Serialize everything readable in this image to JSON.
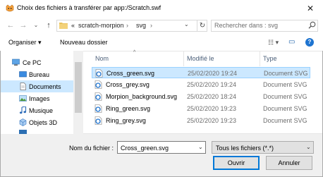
{
  "window": {
    "title": "Choix des fichiers à transférer par app:/Scratch.swf",
    "close_glyph": "✕"
  },
  "nav": {
    "back_glyph": "←",
    "forward_glyph": "→",
    "recent_glyph": "⌄",
    "up_glyph": "↑",
    "breadcrumb_prefix": "«",
    "breadcrumbs": [
      "scratch-morpion",
      "svg"
    ],
    "separator": "›",
    "refresh_glyph": "↻",
    "dropdown_glyph": "⌄",
    "search_placeholder": "Rechercher dans : svg"
  },
  "toolbar": {
    "organize_label": "Organiser ▾",
    "new_folder_label": "Nouveau dossier",
    "view_glyph": "☷ ▾",
    "pane_glyph": "▭",
    "help_glyph": "?"
  },
  "sidebar": {
    "items": [
      {
        "label": "Ce PC",
        "icon": "computer-icon"
      },
      {
        "label": "Bureau",
        "icon": "desktop-icon"
      },
      {
        "label": "Documents",
        "icon": "documents-icon"
      },
      {
        "label": "Images",
        "icon": "images-icon"
      },
      {
        "label": "Musique",
        "icon": "music-icon"
      },
      {
        "label": "Objets 3D",
        "icon": "objects3d-icon"
      }
    ],
    "selected_index": 2
  },
  "columns": {
    "name": "Nom",
    "modified": "Modifié le",
    "type": "Type"
  },
  "files": [
    {
      "name": "Cross_green.svg",
      "modified": "25/02/2020 19:24",
      "type": "Document SVG",
      "selected": true
    },
    {
      "name": "Cross_grey.svg",
      "modified": "25/02/2020 19:24",
      "type": "Document SVG",
      "selected": false
    },
    {
      "name": "Morpion_background.svg",
      "modified": "25/02/2020 18:24",
      "type": "Document SVG",
      "selected": false
    },
    {
      "name": "Ring_green.svg",
      "modified": "25/02/2020 19:23",
      "type": "Document SVG",
      "selected": false
    },
    {
      "name": "Ring_grey.svg",
      "modified": "25/02/2020 19:23",
      "type": "Document SVG",
      "selected": false
    }
  ],
  "footer": {
    "filename_label": "Nom du fichier :",
    "filename_value": "Cross_green.svg",
    "filter_value": "Tous les fichiers (*.*)",
    "open_label": "Ouvrir",
    "cancel_label": "Annuler"
  },
  "colors": {
    "accent": "#0078d7",
    "selection": "#cce8ff",
    "folder": "#e8c25e"
  }
}
